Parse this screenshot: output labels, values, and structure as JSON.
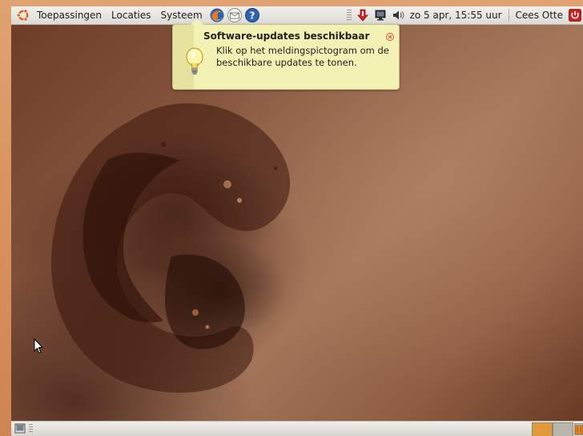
{
  "top_panel": {
    "menus": [
      "Toepassingen",
      "Locaties",
      "Systeem"
    ],
    "launchers": [
      "firefox-icon",
      "mail-icon",
      "help-icon"
    ],
    "tray": [
      "update-notifier-icon",
      "network-icon",
      "volume-icon"
    ],
    "clock": "zo  5 apr, 15:55 uur",
    "user": "Cees Otte",
    "power_icon": "power-icon"
  },
  "notification": {
    "title": "Software-updates beschikbaar",
    "body": "Klik op het meldingspictogram om de beschikbare updates te tonen.",
    "icon": "lightbulb-icon",
    "close_icon": "close-icon"
  },
  "bottom_panel": {
    "show_desktop_icon": "show-desktop-icon",
    "workspaces": [
      "workspace-1",
      "workspace-2"
    ],
    "trash_icon": "trash-icon"
  },
  "colors": {
    "panel": "#dcdad5",
    "notification_bg": "#f4f1b4",
    "workspace_active": "#e09a3a",
    "wallpaper_base": "#8a5a42"
  }
}
